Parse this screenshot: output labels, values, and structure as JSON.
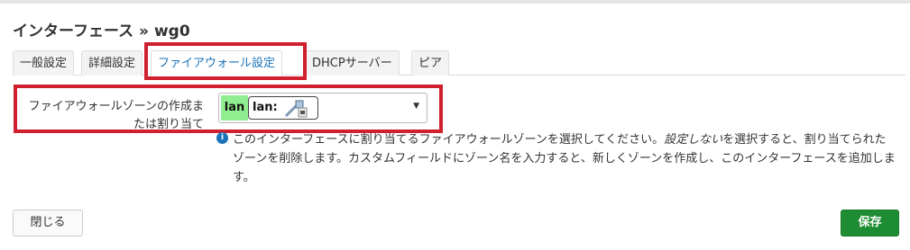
{
  "modal": {
    "title": "インターフェース » wg0"
  },
  "tabs": [
    {
      "label": "一般設定"
    },
    {
      "label": "詳細設定"
    },
    {
      "label": "ファイアウォール設定"
    },
    {
      "label": "DHCPサーバー"
    },
    {
      "label": "ピア"
    }
  ],
  "firewall_zone": {
    "label": "ファイアウォールゾーンの作成または割り当て",
    "selected_zone": "lan",
    "zone_color": "#90ee90",
    "selected_interface": "lan:",
    "interface_icon": "ethernet-port-icon",
    "help_prefix": "このインターフェースに割り当てるファイアウォールゾーンを選択してください。",
    "help_emphasis": "設定しない",
    "help_suffix": "を選択すると、割り当てられたゾーンを削除します。カスタムフィールドにゾーン名を入力すると、新しくゾーンを作成し、このインターフェースを追加します。"
  },
  "footer": {
    "close_label": "閉じる",
    "save_label": "保存"
  },
  "colors": {
    "highlight": "#d0202f",
    "save": "#1e8c33",
    "active_tab_text": "#1a73b8"
  }
}
